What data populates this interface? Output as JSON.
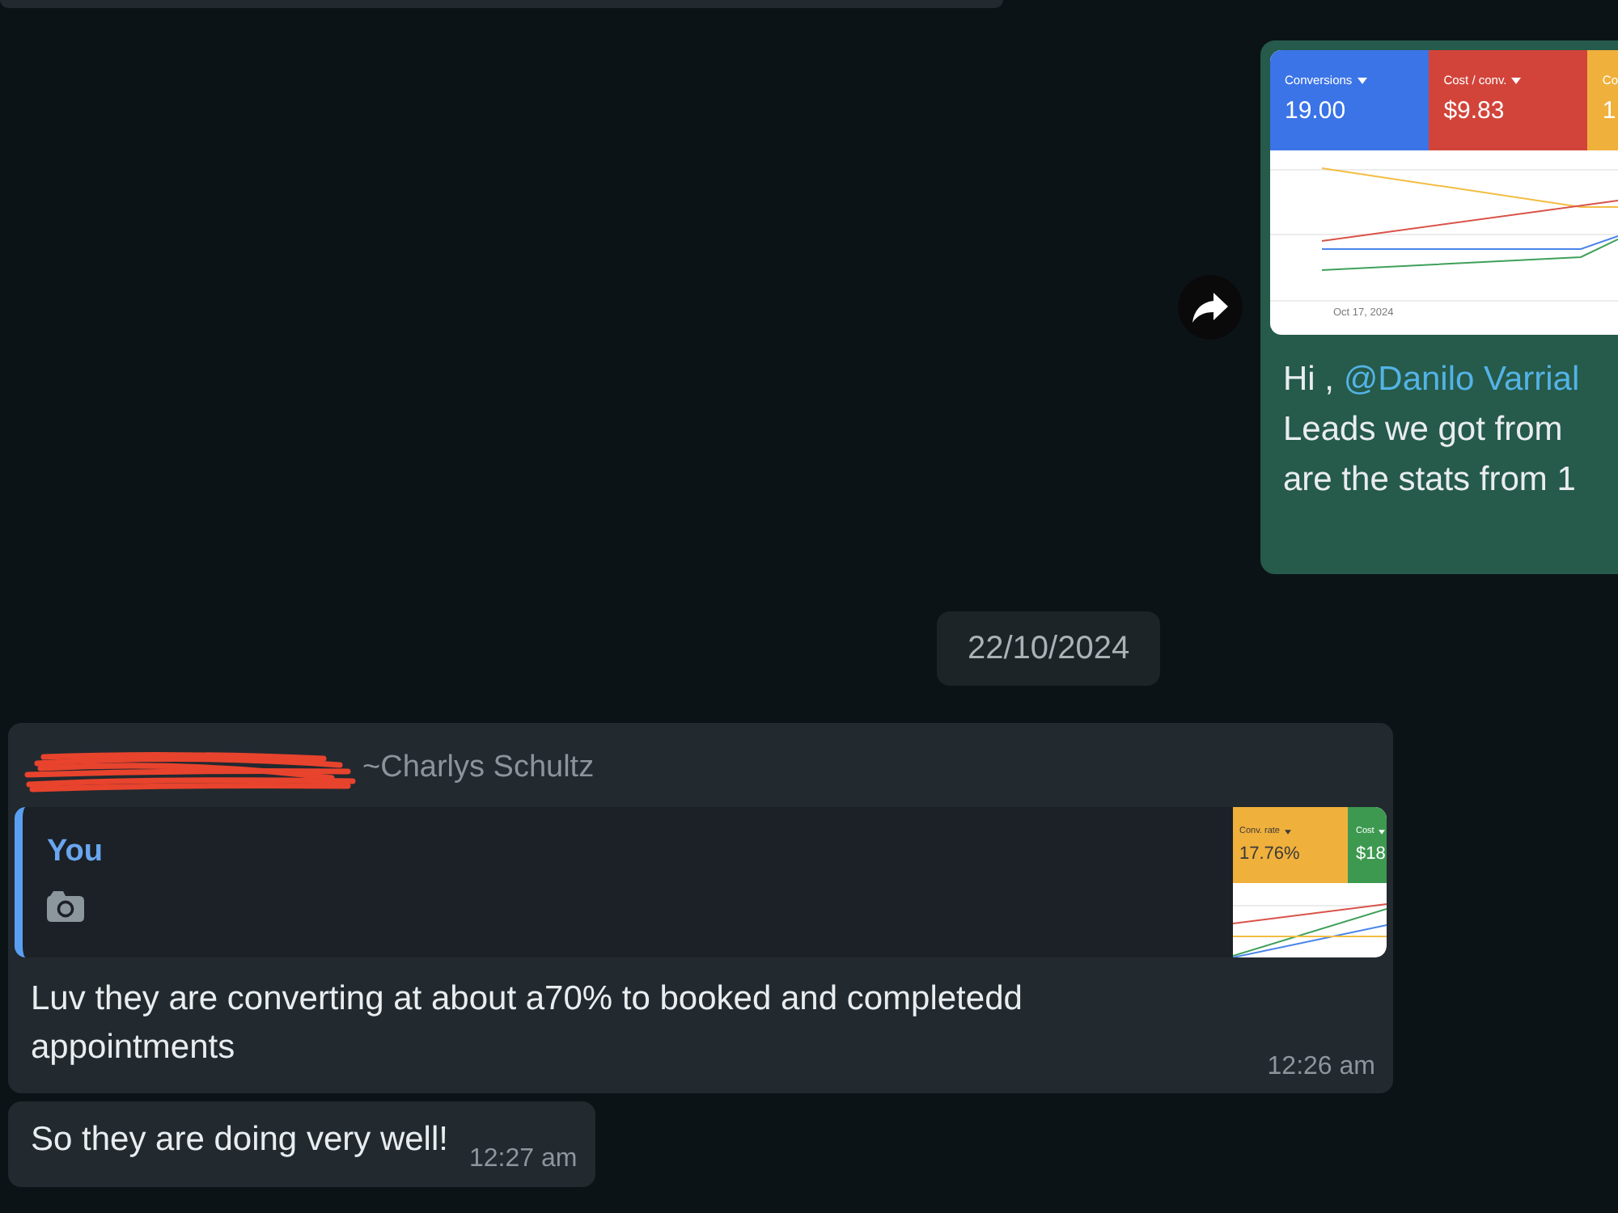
{
  "messages": [
    {
      "kind": "outgoing",
      "image": {
        "tiles": [
          {
            "label": "Conversions",
            "value": "19.00",
            "color": "#3b74e6",
            "caret": true
          },
          {
            "label": "Cost / conv.",
            "value": "$9.83",
            "color": "#d2443a",
            "caret": true
          },
          {
            "label": "Co",
            "value": "1",
            "color": "#f0b03c",
            "caret": false
          }
        ],
        "date_label": "Oct 17, 2024"
      },
      "text": {
        "greeting": "Hi , ",
        "mention": "@Danilo Varrial",
        "lines": [
          "Leads we got from",
          "are the stats from 1"
        ]
      }
    },
    {
      "kind": "date",
      "label": "22/10/2024"
    },
    {
      "kind": "incoming",
      "sender": "~Charlys Schultz",
      "redacted": true,
      "quote": {
        "author": "You",
        "photo": true,
        "thumbnail": {
          "tiles": [
            {
              "label": "Conv. rate",
              "value": "17.76%",
              "color": "#f0b03c",
              "caret": true
            },
            {
              "label": "Cost",
              "value": "$18",
              "color": "#3d9950",
              "caret": true
            }
          ]
        }
      },
      "text": "Luv they are converting at about a70% to booked and completedd appointments",
      "time": "12:26 am"
    },
    {
      "kind": "incoming",
      "text": "So they are doing very well!",
      "time": "12:27 am"
    }
  ]
}
